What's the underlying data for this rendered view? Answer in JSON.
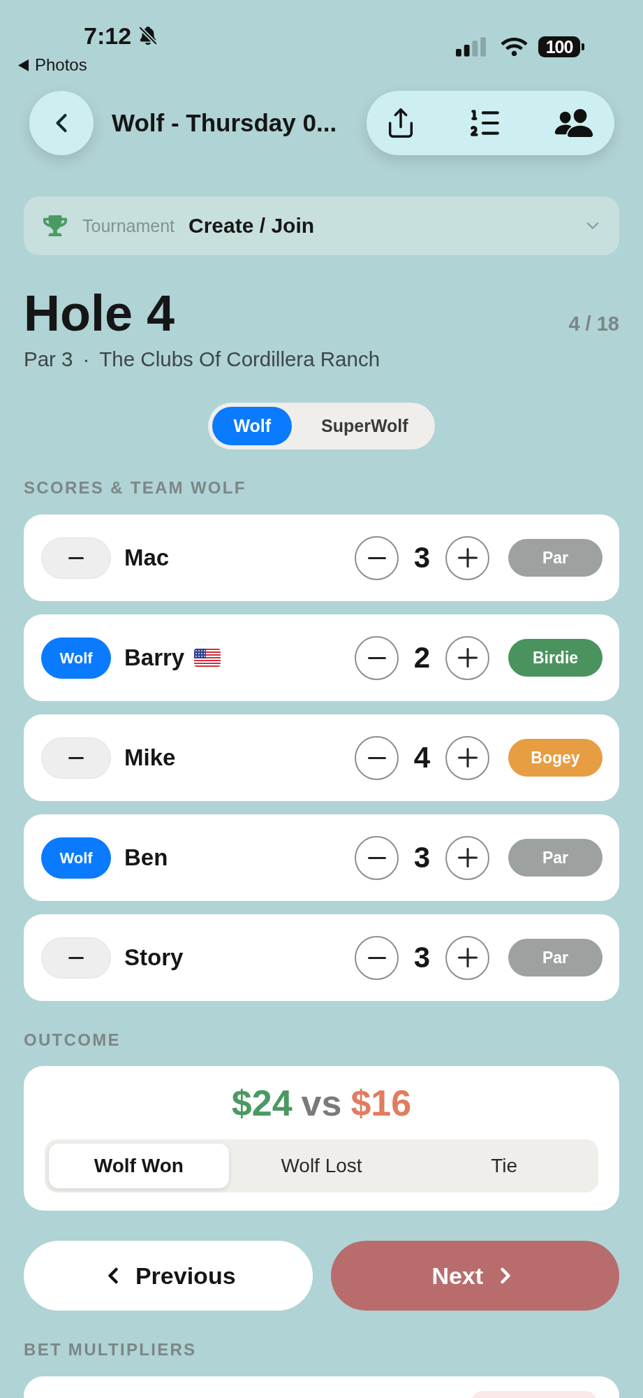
{
  "status_bar": {
    "time": "7:12",
    "back_app": "Photos",
    "battery": "100"
  },
  "header": {
    "title": "Wolf - Thursday 0..."
  },
  "tournament": {
    "label": "Tournament",
    "value": "Create / Join"
  },
  "hole": {
    "title": "Hole 4",
    "count": "4 / 18",
    "par": "Par 3",
    "separator": "·",
    "course": "The Clubs Of Cordillera Ranch"
  },
  "game_modes": [
    {
      "label": "Wolf",
      "selected": true
    },
    {
      "label": "SuperWolf",
      "selected": false
    }
  ],
  "scores": {
    "heading": "SCORES & TEAM WOLF",
    "players": [
      {
        "name": "Mac",
        "wolf": false,
        "score": "3",
        "result": {
          "label": "Par",
          "color": "#9da19f"
        }
      },
      {
        "name": "Barry",
        "wolf": true,
        "wolf_label": "Wolf",
        "flag": true,
        "score": "2",
        "result": {
          "label": "Birdie",
          "color": "#4a935e"
        }
      },
      {
        "name": "Mike",
        "wolf": false,
        "score": "4",
        "result": {
          "label": "Bogey",
          "color": "#e79d42"
        }
      },
      {
        "name": "Ben",
        "wolf": true,
        "wolf_label": "Wolf",
        "score": "3",
        "result": {
          "label": "Par",
          "color": "#9da19f"
        }
      },
      {
        "name": "Story",
        "wolf": false,
        "score": "3",
        "result": {
          "label": "Par",
          "color": "#9da19f"
        }
      }
    ]
  },
  "outcome": {
    "heading": "OUTCOME",
    "wolf_amount": "$24",
    "separator": "vs",
    "others_amount": "$16",
    "options": [
      {
        "label": "Wolf Won",
        "selected": true
      },
      {
        "label": "Wolf Lost",
        "selected": false
      },
      {
        "label": "Tie",
        "selected": false
      }
    ]
  },
  "navigation": {
    "previous": "Previous",
    "next": "Next"
  },
  "bet_multipliers": {
    "heading": "BET MULTIPLIERS"
  }
}
